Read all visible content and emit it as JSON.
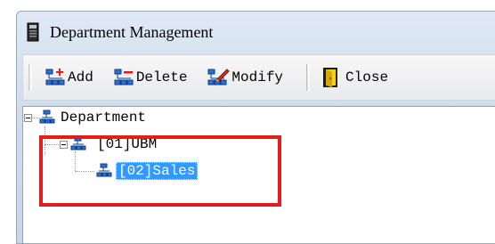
{
  "window": {
    "title": "Department Management"
  },
  "toolbar": {
    "add_label": "Add",
    "delete_label": "Delete",
    "modify_label": "Modify",
    "close_label": "Close"
  },
  "tree": {
    "root": {
      "label": "Department",
      "expanded": true
    },
    "children": [
      {
        "label": "[01]UBM",
        "expanded": true
      },
      {
        "label": "[02]Sales",
        "selected": true
      }
    ]
  },
  "colors": {
    "highlight_border": "#e31d1d",
    "selection": "#3399ff"
  }
}
